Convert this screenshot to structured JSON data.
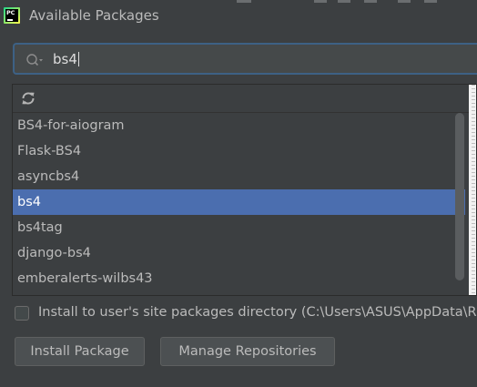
{
  "window": {
    "title": "Available Packages",
    "app_icon": "pycharm-icon",
    "app_icon_text": "PC"
  },
  "search": {
    "icon": "search-icon",
    "value": "bs4"
  },
  "toolbar": {
    "refresh_icon": "refresh-icon"
  },
  "packages": {
    "items": [
      {
        "label": "BS4-for-aiogram"
      },
      {
        "label": "Flask-BS4"
      },
      {
        "label": "asyncbs4"
      },
      {
        "label": "bs4"
      },
      {
        "label": "bs4tag"
      },
      {
        "label": "django-bs4"
      },
      {
        "label": "emberalerts-wilbs43"
      }
    ],
    "selected": "bs4"
  },
  "options": {
    "user_site_label": "Install to user's site packages directory (C:\\Users\\ASUS\\AppData\\R",
    "user_site_checked": false
  },
  "buttons": {
    "install_label": "Install Package",
    "manage_label": "Manage Repositories"
  },
  "colors": {
    "background": "#3c3f41",
    "selection": "#4b6eaf",
    "search_border": "#3d6185",
    "text": "#bbbbbb"
  }
}
